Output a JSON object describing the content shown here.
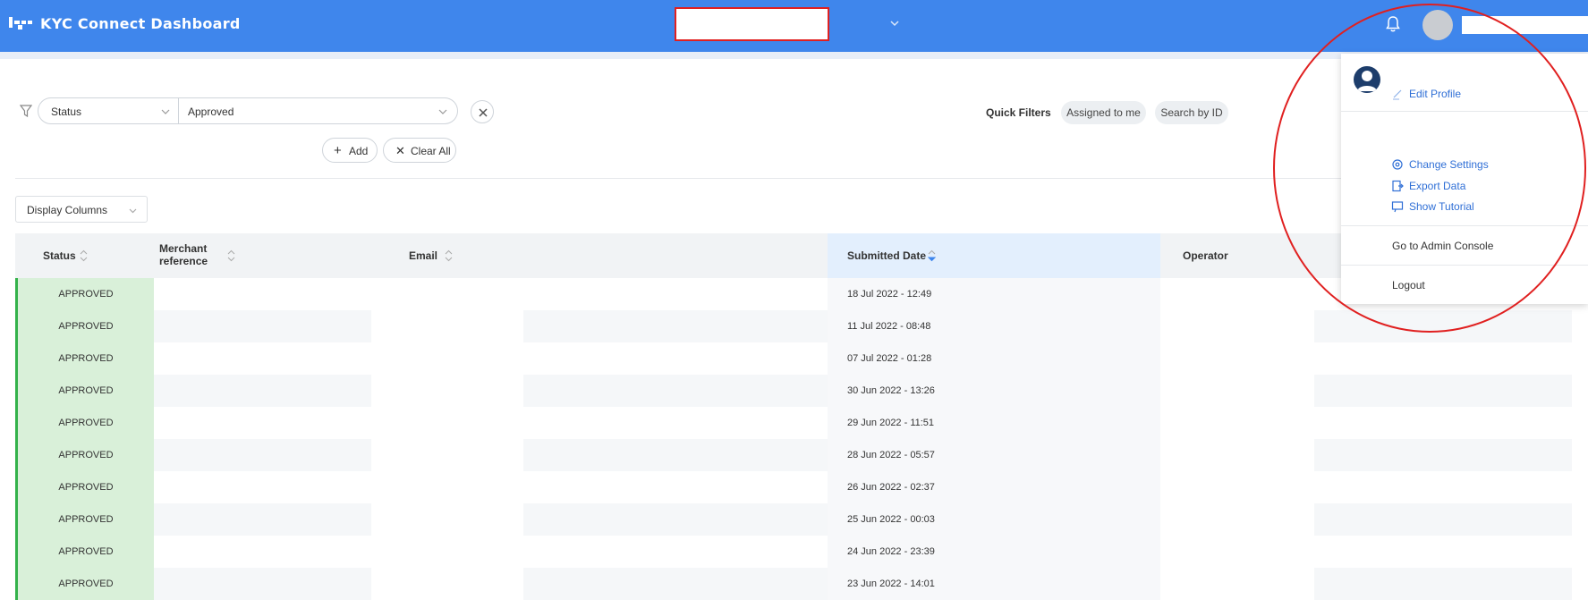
{
  "header": {
    "app_title": "KYC Connect Dashboard",
    "logo_icon": "logo-icon",
    "notification_icon": "bell-icon"
  },
  "filters": {
    "field_label": "Status",
    "value_label": "Approved",
    "add_label": "Add",
    "clear_all_label": "Clear All",
    "quick_filters_label": "Quick Filters",
    "quick_filters": [
      "Assigned to me",
      "Search by ID"
    ]
  },
  "display_columns": "Display Columns",
  "table": {
    "columns": [
      "Status",
      "Merchant reference",
      "Email",
      "Submitted Date",
      "Operator"
    ],
    "merchant_line1": "Merchant",
    "merchant_line2": "reference",
    "rows": [
      {
        "status": "APPROVED",
        "date": "18 Jul 2022 - 12:49"
      },
      {
        "status": "APPROVED",
        "date": "11 Jul 2022 - 08:48"
      },
      {
        "status": "APPROVED",
        "date": "07 Jul 2022 - 01:28"
      },
      {
        "status": "APPROVED",
        "date": "30 Jun 2022 - 13:26"
      },
      {
        "status": "APPROVED",
        "date": "29 Jun 2022 - 11:51"
      },
      {
        "status": "APPROVED",
        "date": "28 Jun 2022 - 05:57"
      },
      {
        "status": "APPROVED",
        "date": "26 Jun 2022 - 02:37"
      },
      {
        "status": "APPROVED",
        "date": "25 Jun 2022 - 00:03"
      },
      {
        "status": "APPROVED",
        "date": "24 Jun 2022 - 23:39"
      },
      {
        "status": "APPROVED",
        "date": "23 Jun 2022 - 14:01"
      }
    ]
  },
  "menu": {
    "edit_profile": "Edit Profile",
    "change_settings": "Change Settings",
    "export_data": "Export Data",
    "show_tutorial": "Show Tutorial",
    "admin_console": "Go to Admin Console",
    "logout": "Logout"
  },
  "colors": {
    "header_bg": "#3f86ec",
    "approved_bg": "#d9f0d9",
    "approved_border": "#34b24a",
    "link": "#2f6fd6",
    "annotation": "#e02020"
  }
}
